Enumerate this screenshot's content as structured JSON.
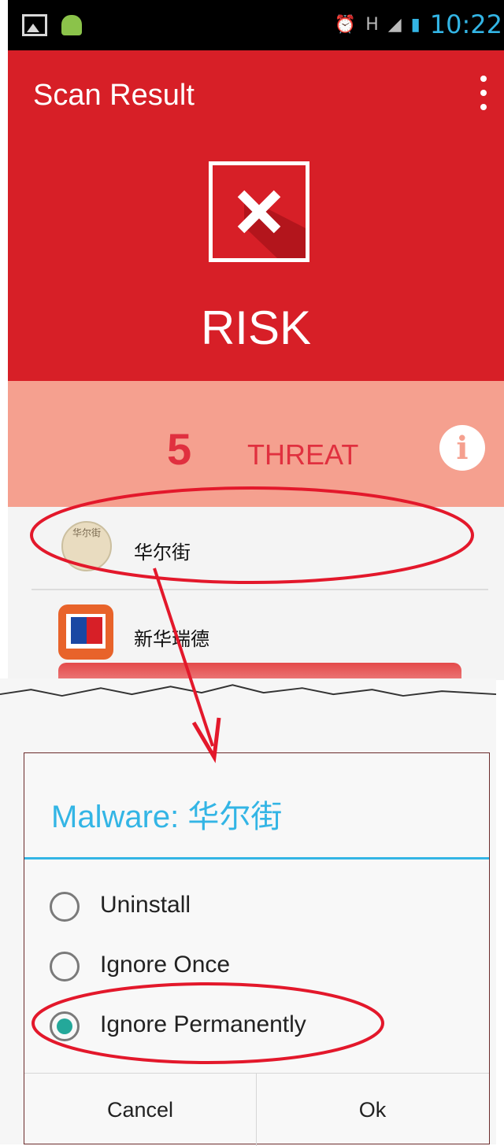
{
  "status_bar": {
    "time": "10:22",
    "network": "H",
    "icons": [
      "gallery-icon",
      "android-icon",
      "alarm-icon",
      "signal-icon",
      "battery-icon"
    ]
  },
  "app": {
    "title": "Scan Result",
    "overflow_icon": "overflow-menu-icon"
  },
  "result": {
    "icon": "close-x-icon",
    "status": "RISK",
    "threat_count": "5",
    "threat_label": "THREAT",
    "info_icon": "i"
  },
  "threats": [
    {
      "name": "华尔街",
      "icon_text": "华尔街"
    },
    {
      "name": "新华瑞德"
    }
  ],
  "dialog": {
    "title": "Malware: 华尔街",
    "options": [
      {
        "label": "Uninstall",
        "selected": false
      },
      {
        "label": "Ignore Once",
        "selected": false
      },
      {
        "label": "Ignore Permanently",
        "selected": true
      }
    ],
    "cancel": "Cancel",
    "ok": "Ok"
  },
  "colors": {
    "header_red": "#d71f27",
    "threat_bar": "#f5a08f",
    "threat_text": "#e0303f",
    "accent_blue": "#33b5e5",
    "radio_selected": "#24a89a",
    "annotation_red": "#e3182b"
  }
}
